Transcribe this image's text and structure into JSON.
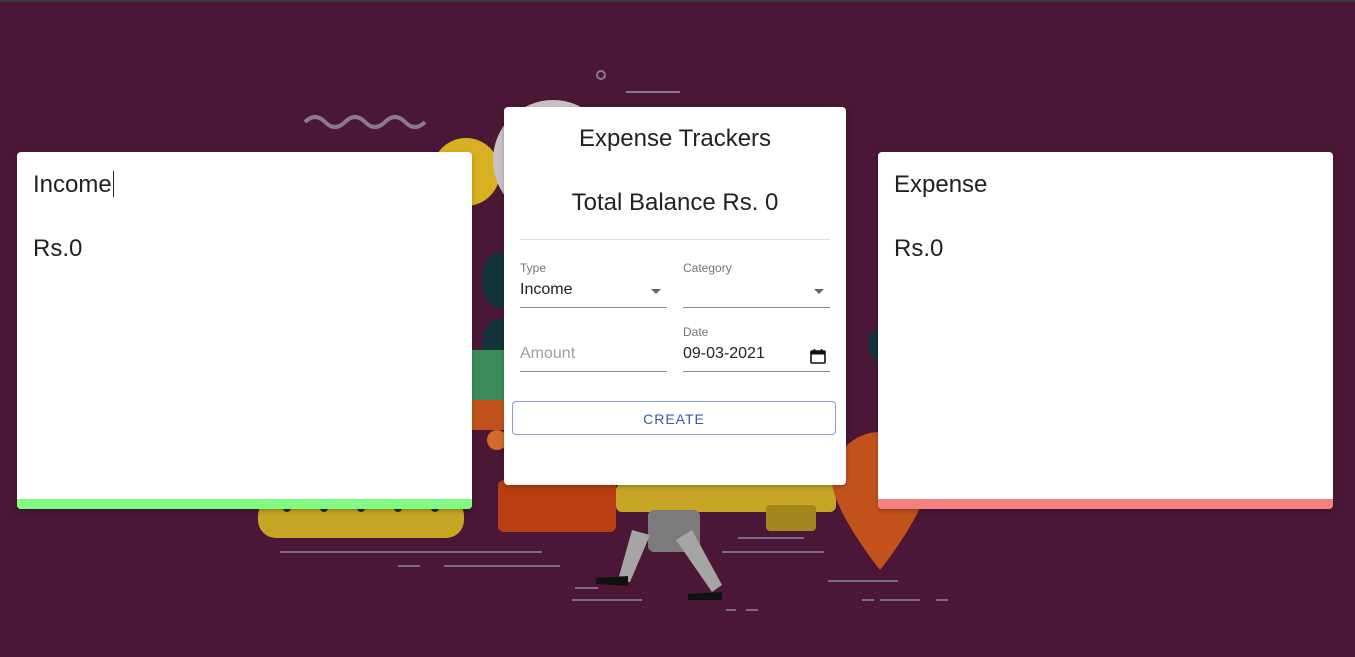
{
  "app": {
    "title": "Expense Trackers",
    "total_balance": "Total Balance Rs. 0"
  },
  "income_card": {
    "title": "Income",
    "amount": "Rs.0",
    "accent_color": "#80fa80"
  },
  "expense_card": {
    "title": "Expense",
    "amount": "Rs.0",
    "accent_color": "#f77f7f"
  },
  "form": {
    "type": {
      "label": "Type",
      "value": "Income"
    },
    "category": {
      "label": "Category",
      "value": ""
    },
    "amount": {
      "placeholder": "Amount",
      "value": ""
    },
    "date": {
      "label": "Date",
      "value": "09-03-2021"
    },
    "create_label": "CREATE"
  },
  "icons": {
    "type_dropdown": "chevron-down-icon",
    "category_dropdown": "chevron-down-icon",
    "date_picker": "calendar-icon"
  },
  "colors": {
    "background": "#4a1736",
    "button_accent": "#3f51b5"
  }
}
